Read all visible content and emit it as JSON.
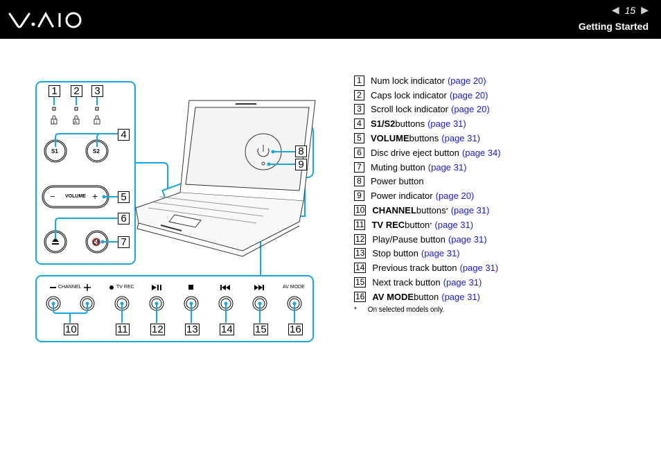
{
  "header": {
    "brand": "VAIO",
    "page_number": "15",
    "prev_icon": "prev-page-arrow-icon",
    "next_icon": "next-page-arrow-icon",
    "section_title": "Getting Started"
  },
  "figure": {
    "panel_left": {
      "callouts": [
        "1",
        "2",
        "3",
        "4",
        "5",
        "6",
        "7"
      ],
      "lock_icons": [
        "num-lock-icon",
        "caps-lock-icon",
        "scroll-lock-icon"
      ],
      "s1_label": "S1",
      "s2_label": "S2",
      "volume_label": "VOLUME",
      "volume_minus": "−",
      "volume_plus": "+"
    },
    "panel_power": {
      "callouts": [
        "8",
        "9"
      ]
    },
    "panel_bottom": {
      "labels": {
        "channel": "CHANNEL",
        "tv_rec": "TV REC",
        "av_mode": "AV MODE"
      },
      "callouts": [
        "10",
        "11",
        "12",
        "13",
        "14",
        "15",
        "16"
      ]
    }
  },
  "legend": {
    "items": [
      {
        "num": "1",
        "bold": "",
        "text": "Num lock indicator",
        "sup": "",
        "link": "(page 20)"
      },
      {
        "num": "2",
        "bold": "",
        "text": "Caps lock indicator",
        "sup": "",
        "link": "(page 20)"
      },
      {
        "num": "3",
        "bold": "",
        "text": "Scroll lock indicator",
        "sup": "",
        "link": "(page 20)"
      },
      {
        "num": "4",
        "bold": "S1/S2",
        "text": " buttons",
        "sup": "",
        "link": "(page 31)"
      },
      {
        "num": "5",
        "bold": "VOLUME",
        "text": " buttons",
        "sup": "",
        "link": "(page 31)"
      },
      {
        "num": "6",
        "bold": "",
        "text": "Disc drive eject button",
        "sup": "",
        "link": "(page 34)"
      },
      {
        "num": "7",
        "bold": "",
        "text": "Muting button",
        "sup": "",
        "link": "(page 31)"
      },
      {
        "num": "8",
        "bold": "",
        "text": "Power button",
        "sup": "",
        "link": ""
      },
      {
        "num": "9",
        "bold": "",
        "text": "Power indicator",
        "sup": "",
        "link": "(page 20)"
      },
      {
        "num": "10",
        "bold": "CHANNEL",
        "text": " buttons",
        "sup": "*",
        "link": "(page 31)"
      },
      {
        "num": "11",
        "bold": "TV REC",
        "text": " button",
        "sup": "*",
        "link": "(page 31)"
      },
      {
        "num": "12",
        "bold": "",
        "text": "Play/Pause button",
        "sup": "",
        "link": "(page 31)"
      },
      {
        "num": "13",
        "bold": "",
        "text": "Stop button",
        "sup": "",
        "link": "(page 31)"
      },
      {
        "num": "14",
        "bold": "",
        "text": "Previous track button",
        "sup": "",
        "link": "(page 31)"
      },
      {
        "num": "15",
        "bold": "",
        "text": "Next track button",
        "sup": "",
        "link": "(page 31)"
      },
      {
        "num": "16",
        "bold": "AV MODE",
        "text": " button",
        "sup": "",
        "link": "(page 31)"
      }
    ],
    "footnote_star": "*",
    "footnote": "On selected models only."
  },
  "colors": {
    "header_bg": "#000000",
    "callout_line": "#14a8e0",
    "link": "#1a1adc"
  }
}
